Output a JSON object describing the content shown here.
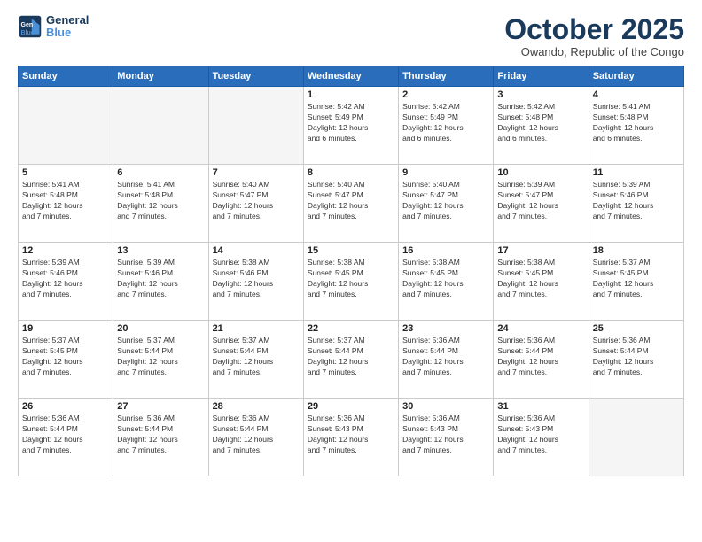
{
  "logo": {
    "line1": "General",
    "line2": "Blue"
  },
  "title": "October 2025",
  "subtitle": "Owando, Republic of the Congo",
  "weekdays": [
    "Sunday",
    "Monday",
    "Tuesday",
    "Wednesday",
    "Thursday",
    "Friday",
    "Saturday"
  ],
  "weeks": [
    [
      {
        "day": "",
        "info": ""
      },
      {
        "day": "",
        "info": ""
      },
      {
        "day": "",
        "info": ""
      },
      {
        "day": "1",
        "info": "Sunrise: 5:42 AM\nSunset: 5:49 PM\nDaylight: 12 hours\nand 6 minutes."
      },
      {
        "day": "2",
        "info": "Sunrise: 5:42 AM\nSunset: 5:49 PM\nDaylight: 12 hours\nand 6 minutes."
      },
      {
        "day": "3",
        "info": "Sunrise: 5:42 AM\nSunset: 5:48 PM\nDaylight: 12 hours\nand 6 minutes."
      },
      {
        "day": "4",
        "info": "Sunrise: 5:41 AM\nSunset: 5:48 PM\nDaylight: 12 hours\nand 6 minutes."
      }
    ],
    [
      {
        "day": "5",
        "info": "Sunrise: 5:41 AM\nSunset: 5:48 PM\nDaylight: 12 hours\nand 7 minutes."
      },
      {
        "day": "6",
        "info": "Sunrise: 5:41 AM\nSunset: 5:48 PM\nDaylight: 12 hours\nand 7 minutes."
      },
      {
        "day": "7",
        "info": "Sunrise: 5:40 AM\nSunset: 5:47 PM\nDaylight: 12 hours\nand 7 minutes."
      },
      {
        "day": "8",
        "info": "Sunrise: 5:40 AM\nSunset: 5:47 PM\nDaylight: 12 hours\nand 7 minutes."
      },
      {
        "day": "9",
        "info": "Sunrise: 5:40 AM\nSunset: 5:47 PM\nDaylight: 12 hours\nand 7 minutes."
      },
      {
        "day": "10",
        "info": "Sunrise: 5:39 AM\nSunset: 5:47 PM\nDaylight: 12 hours\nand 7 minutes."
      },
      {
        "day": "11",
        "info": "Sunrise: 5:39 AM\nSunset: 5:46 PM\nDaylight: 12 hours\nand 7 minutes."
      }
    ],
    [
      {
        "day": "12",
        "info": "Sunrise: 5:39 AM\nSunset: 5:46 PM\nDaylight: 12 hours\nand 7 minutes."
      },
      {
        "day": "13",
        "info": "Sunrise: 5:39 AM\nSunset: 5:46 PM\nDaylight: 12 hours\nand 7 minutes."
      },
      {
        "day": "14",
        "info": "Sunrise: 5:38 AM\nSunset: 5:46 PM\nDaylight: 12 hours\nand 7 minutes."
      },
      {
        "day": "15",
        "info": "Sunrise: 5:38 AM\nSunset: 5:45 PM\nDaylight: 12 hours\nand 7 minutes."
      },
      {
        "day": "16",
        "info": "Sunrise: 5:38 AM\nSunset: 5:45 PM\nDaylight: 12 hours\nand 7 minutes."
      },
      {
        "day": "17",
        "info": "Sunrise: 5:38 AM\nSunset: 5:45 PM\nDaylight: 12 hours\nand 7 minutes."
      },
      {
        "day": "18",
        "info": "Sunrise: 5:37 AM\nSunset: 5:45 PM\nDaylight: 12 hours\nand 7 minutes."
      }
    ],
    [
      {
        "day": "19",
        "info": "Sunrise: 5:37 AM\nSunset: 5:45 PM\nDaylight: 12 hours\nand 7 minutes."
      },
      {
        "day": "20",
        "info": "Sunrise: 5:37 AM\nSunset: 5:44 PM\nDaylight: 12 hours\nand 7 minutes."
      },
      {
        "day": "21",
        "info": "Sunrise: 5:37 AM\nSunset: 5:44 PM\nDaylight: 12 hours\nand 7 minutes."
      },
      {
        "day": "22",
        "info": "Sunrise: 5:37 AM\nSunset: 5:44 PM\nDaylight: 12 hours\nand 7 minutes."
      },
      {
        "day": "23",
        "info": "Sunrise: 5:36 AM\nSunset: 5:44 PM\nDaylight: 12 hours\nand 7 minutes."
      },
      {
        "day": "24",
        "info": "Sunrise: 5:36 AM\nSunset: 5:44 PM\nDaylight: 12 hours\nand 7 minutes."
      },
      {
        "day": "25",
        "info": "Sunrise: 5:36 AM\nSunset: 5:44 PM\nDaylight: 12 hours\nand 7 minutes."
      }
    ],
    [
      {
        "day": "26",
        "info": "Sunrise: 5:36 AM\nSunset: 5:44 PM\nDaylight: 12 hours\nand 7 minutes."
      },
      {
        "day": "27",
        "info": "Sunrise: 5:36 AM\nSunset: 5:44 PM\nDaylight: 12 hours\nand 7 minutes."
      },
      {
        "day": "28",
        "info": "Sunrise: 5:36 AM\nSunset: 5:44 PM\nDaylight: 12 hours\nand 7 minutes."
      },
      {
        "day": "29",
        "info": "Sunrise: 5:36 AM\nSunset: 5:43 PM\nDaylight: 12 hours\nand 7 minutes."
      },
      {
        "day": "30",
        "info": "Sunrise: 5:36 AM\nSunset: 5:43 PM\nDaylight: 12 hours\nand 7 minutes."
      },
      {
        "day": "31",
        "info": "Sunrise: 5:36 AM\nSunset: 5:43 PM\nDaylight: 12 hours\nand 7 minutes."
      },
      {
        "day": "",
        "info": ""
      }
    ]
  ]
}
